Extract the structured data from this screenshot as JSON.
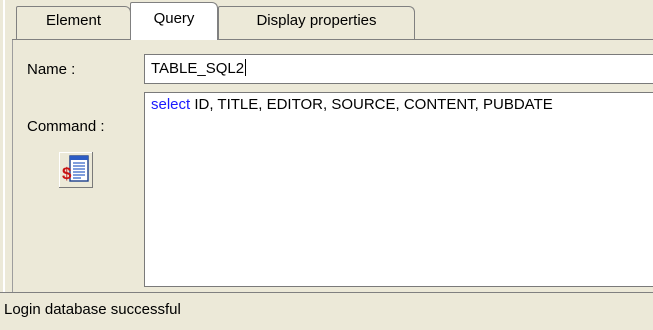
{
  "tabs": [
    {
      "label": "Element",
      "active": false
    },
    {
      "label": "Query",
      "active": true
    },
    {
      "label": "Display properties",
      "active": false
    }
  ],
  "form": {
    "name_label": "Name :",
    "name_value": "TABLE_SQL2",
    "command_label": "Command :",
    "command_keyword": "select",
    "command_rest": " ID, TITLE, EDITOR, SOURCE, CONTENT, PUBDATE"
  },
  "icons": {
    "sql_button": "sql-dollar-document-icon"
  },
  "status": {
    "text": "Login database successful"
  },
  "colors": {
    "panel_bg": "#ece9d8",
    "keyword": "#1a1aff"
  }
}
